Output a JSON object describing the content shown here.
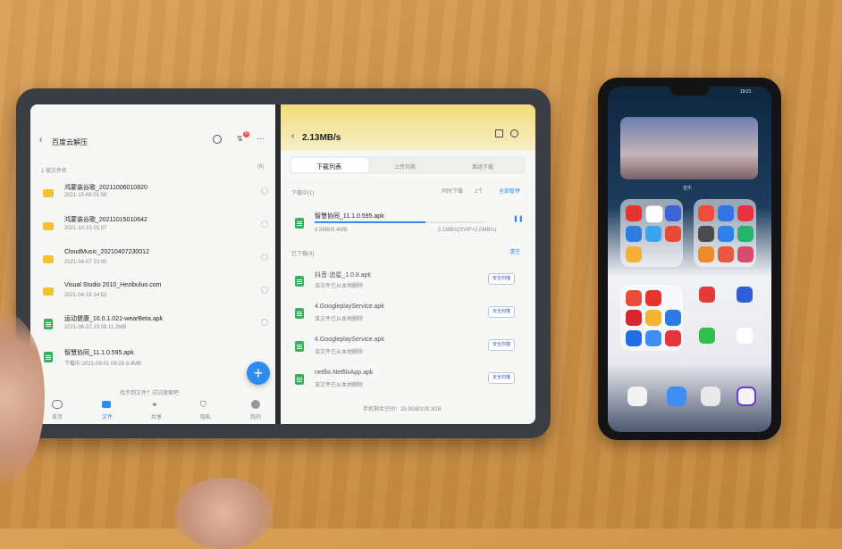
{
  "left_panel": {
    "title": "百度云解压",
    "header_row": "1 按文件名",
    "count": "(6)",
    "files": [
      {
        "name": "鸿蒙装谷歌_20211006010820",
        "meta": "2021-10-06 01:08",
        "type": "folder"
      },
      {
        "name": "鸿蒙装谷歌_20211015010642",
        "meta": "2021-10-15 01:07",
        "type": "folder"
      },
      {
        "name": "CloudMusic_20210407230012",
        "meta": "2021-04-07 23:00",
        "type": "folder"
      },
      {
        "name": "Visual Studio 2010_Hezibuluo.com",
        "meta": "2021-04-18 14:52",
        "type": "folder"
      },
      {
        "name": "运动健康_10.0.1.021-wearBeta.apk",
        "meta": "2021-06-22 23:09  11.2MB",
        "type": "apk"
      },
      {
        "name": "智慧协同_11.1.0.595.apk",
        "meta": "下载中  2021-08-01 09:28  8.4MB",
        "type": "apk"
      }
    ],
    "footer_hint": "找不到文件？试试搜索吧",
    "fab": "+",
    "bottom_nav": [
      "首页",
      "文件",
      "共享",
      "隐私",
      "我的"
    ],
    "notif_badge": "6"
  },
  "right_panel": {
    "speed": "2.13MB/s",
    "tabs": [
      "下载列表",
      "上传列表",
      "离线下载"
    ],
    "downloading_header": "下载中(1)",
    "simultaneous": "同时下载",
    "simultaneous_value": "2个",
    "pause_all": "全部暂停",
    "active_download": {
      "name": "智慧协同_11.1.0.595.apk",
      "size": "8.5MB/8.4MB",
      "speed": "2.1MB/s(SVIP+2.0MB/s)",
      "progress": 0.65
    },
    "done_header": "已下载(4)",
    "clear_label": "清空",
    "downloaded": [
      {
        "name": "抖音·追星_1.0.8.apk",
        "note": "该文件已从本地删除",
        "badge": "安全扫描"
      },
      {
        "name": "4.GoogleplayService.apk",
        "note": "该文件已从本地删除",
        "badge": "安全扫描"
      },
      {
        "name": "4.GoogleplayService.apk",
        "note": "该文件已从本地删除",
        "badge": "安全扫描"
      },
      {
        "name": "netflix.NetflixApp.apk",
        "note": "该文件已从本地删除",
        "badge": "安全扫描"
      }
    ],
    "storage": "手机剩余空间：28.9GB/109.3GB"
  },
  "phone": {
    "time": "19:21",
    "widget_caption": "音乐"
  },
  "colors": {
    "accent": "#2d8cf0",
    "header_yellow": "#f3dc7a",
    "folder": "#f2c230",
    "apk": "#34b35a"
  }
}
